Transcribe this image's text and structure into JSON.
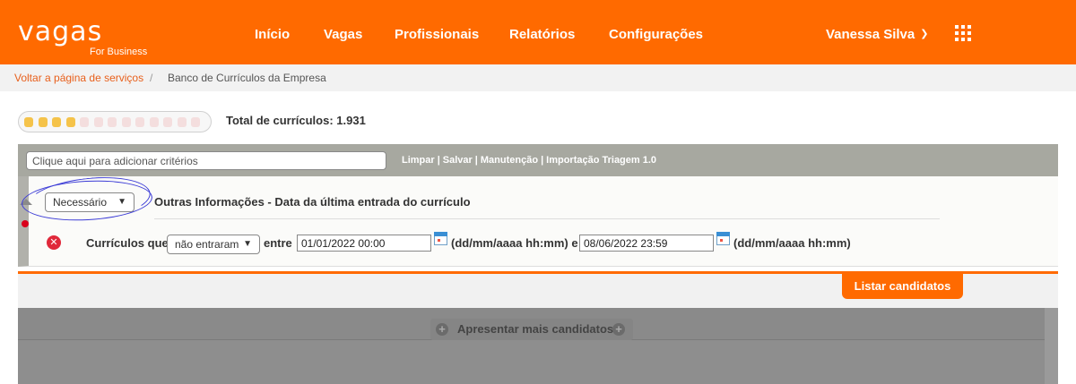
{
  "header": {
    "logo": "vagas",
    "logo_sub": "For Business",
    "nav": [
      "Início",
      "Vagas",
      "Profissionais",
      "Relatórios",
      "Configurações"
    ],
    "user": "Vanessa Silva"
  },
  "breadcrumb": {
    "link": "Voltar a página de serviços",
    "separator": "/",
    "current": "Banco de Currículos da Empresa"
  },
  "progress": {
    "filled": 4,
    "total": 13
  },
  "total_label": "Total de currículos: 1.931",
  "criteria": {
    "placeholder": "Clique aqui para adicionar critérios",
    "actions": [
      "Limpar",
      "Salvar",
      "Manutenção",
      "Importação Triagem 1.0"
    ]
  },
  "filter": {
    "requirement": "Necessário",
    "title": "Outras Informações - Data da última entrada do currículo",
    "label_prefix": "Currículos que",
    "condition": "não entraram",
    "between": "entre",
    "date_from": "01/01/2022 00:00",
    "format_hint_1": "(dd/mm/aaaa hh:mm) e",
    "date_to": "08/06/2022 23:59",
    "format_hint_2": "(dd/mm/aaaa hh:mm)"
  },
  "buttons": {
    "list": "Listar candidatos",
    "more": "Apresentar mais candidatos"
  },
  "colors": {
    "brand": "#ff6a00",
    "annotation": "#3b3bd6"
  }
}
